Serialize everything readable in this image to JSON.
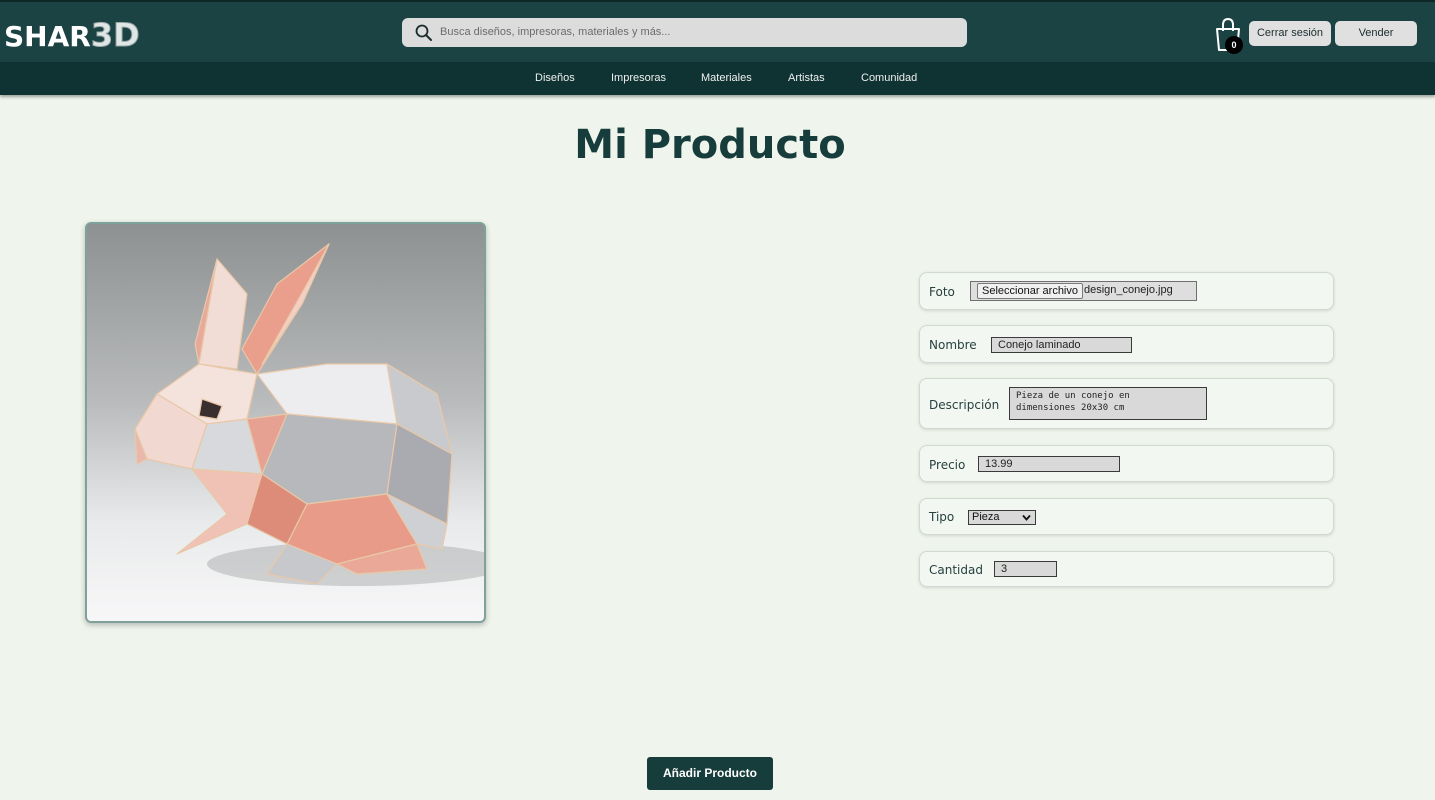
{
  "header": {
    "logo_text": "SHAR",
    "logo_accent": "3D",
    "search_placeholder": "Busca diseños, impresoras, materiales y más...",
    "cart_count": "0",
    "logout_label": "Cerrar sesión",
    "sell_label": "Vender"
  },
  "nav": {
    "items": [
      "Diseños",
      "Impresoras",
      "Materiales",
      "Artistas",
      "Comunidad"
    ]
  },
  "main": {
    "title": "Mi Producto",
    "image_icon": "origami-rabbit-image"
  },
  "form": {
    "photo": {
      "label": "Foto",
      "button": "Seleccionar archivo",
      "file_name": "design_conejo.jpg"
    },
    "name": {
      "label": "Nombre",
      "value": "Conejo laminado"
    },
    "description": {
      "label": "Descripción",
      "value": "Pieza de un conejo en\ndimensiones 20x30 cm"
    },
    "price": {
      "label": "Precio",
      "value": "13.99"
    },
    "type": {
      "label": "Tipo",
      "selected": "Pieza"
    },
    "quantity": {
      "label": "Cantidad",
      "value": "3"
    },
    "submit_label": "Añadir Producto"
  },
  "colors": {
    "header_bg": "#1b4343",
    "nav_bg": "#0f3333",
    "page_bg": "#eff5ec",
    "accent": "#173c3c"
  }
}
